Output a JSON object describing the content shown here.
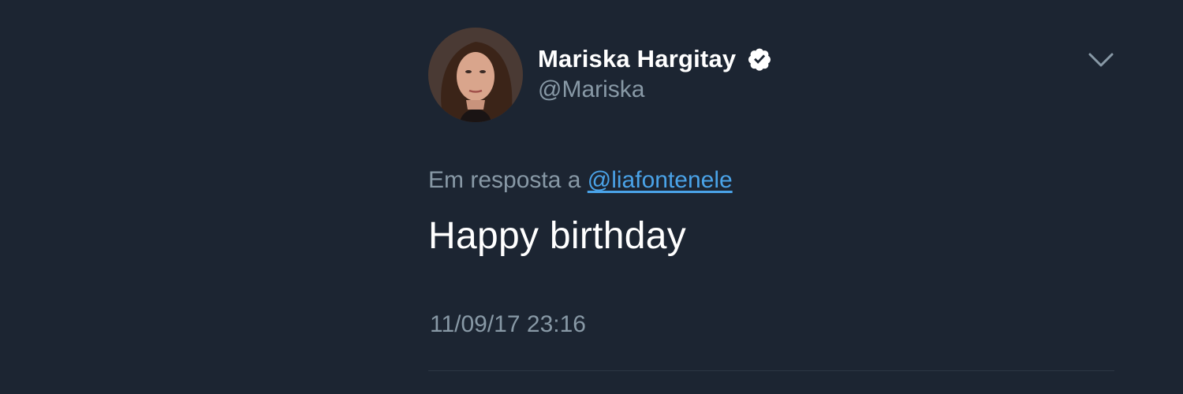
{
  "tweet": {
    "author": {
      "display_name": "Mariska Hargitay",
      "handle": "@Mariska",
      "verified": true,
      "verified_icon": "verified-badge-icon",
      "avatar_icon": "profile-avatar"
    },
    "menu_icon": "chevron-down-icon",
    "reply_prefix": "Em resposta a",
    "reply_to": "@liafontenele",
    "text": "Happy birthday",
    "timestamp": "11/09/17 23:16"
  },
  "colors": {
    "background": "#1c2532",
    "primary_text": "#ffffff",
    "secondary_text": "#8899a6",
    "link": "#4aa3e8"
  }
}
